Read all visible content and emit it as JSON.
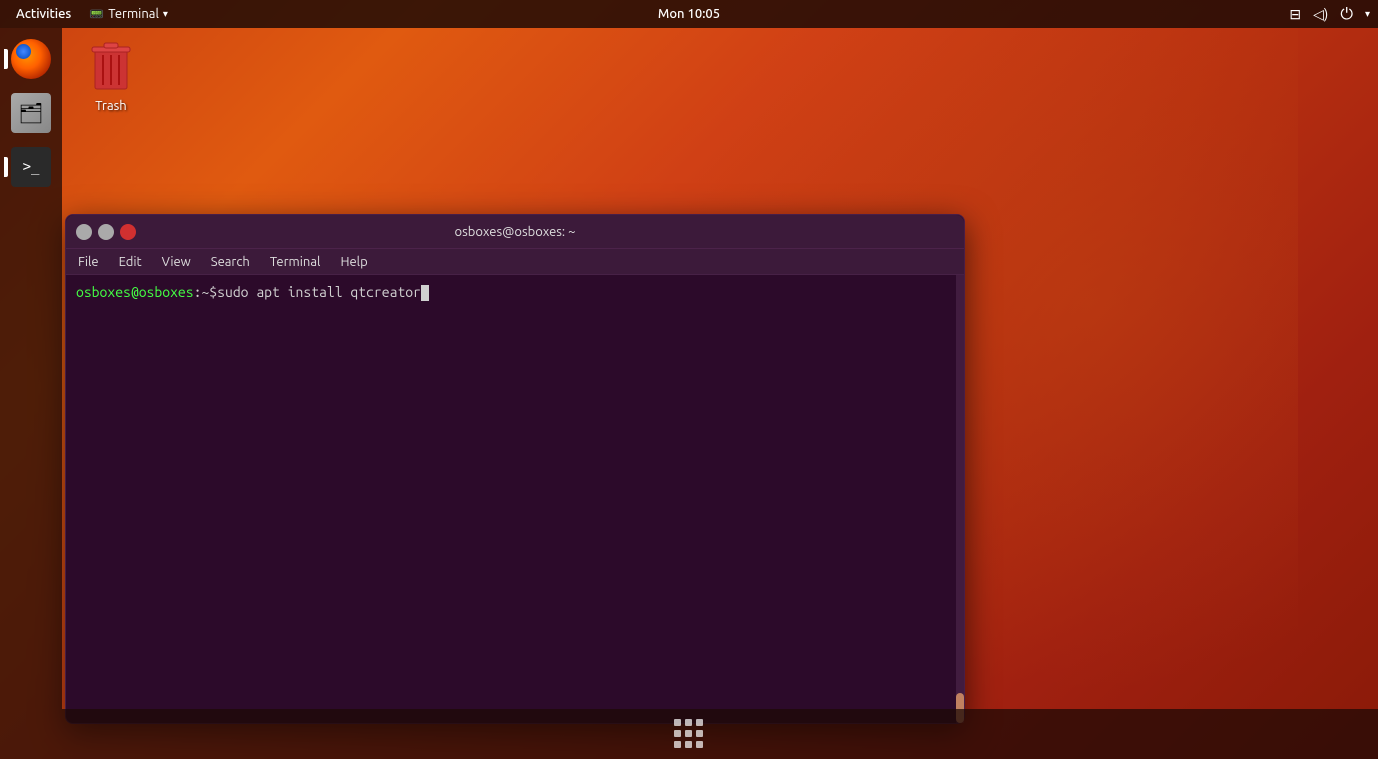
{
  "desktop": {
    "background_desc": "Ubuntu orange gradient desktop"
  },
  "top_panel": {
    "activities": "Activities",
    "terminal_label": "Terminal",
    "terminal_arrow": "▾",
    "clock": "Mon 10:05",
    "network_icon": "⊞",
    "sound_icon": "🔊",
    "power_icon": "⏻",
    "arrow_icon": "▾"
  },
  "trash": {
    "label": "Trash",
    "icon": "🗑"
  },
  "terminal_window": {
    "title": "osboxes@osboxes: ~",
    "menu": {
      "file": "File",
      "edit": "Edit",
      "view": "View",
      "search": "Search",
      "terminal": "Terminal",
      "help": "Help"
    },
    "prompt_user": "osboxes@osboxes",
    "prompt_separator": ":~$",
    "command": " sudo apt install qtcreator"
  },
  "sidebar": {
    "firefox_tooltip": "Firefox Web Browser",
    "files_tooltip": "Files",
    "terminal_tooltip": "Terminal"
  },
  "bottom": {
    "grid_label": "Show Applications"
  }
}
